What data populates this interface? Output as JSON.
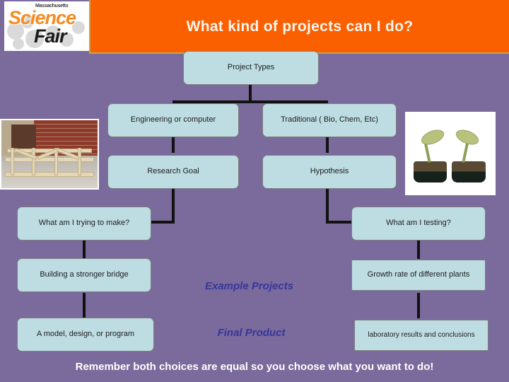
{
  "header": {
    "title": "What kind of projects can I do?",
    "logo": {
      "line_top": "Massachusetts",
      "line_main": "Science",
      "line_sub": "Fair"
    },
    "bar_color": "#fa5f00"
  },
  "theme": {
    "background_color": "#7b6a9c",
    "node_fill": "#bedde3",
    "node_border": "#7e7e7e",
    "connector_color": "#121212",
    "label_color": "#36369b",
    "title_color": "#fdf6ee"
  },
  "diagram": {
    "root": {
      "label": "Project Types"
    },
    "row_types": {
      "left": "Engineering or computer",
      "right": "Traditional ( Bio, Chem, Etc)"
    },
    "row_goal": {
      "left": "Research Goal",
      "right": "Hypothesis"
    },
    "row_question": {
      "left": "What am I trying to make?",
      "right": "What am I testing?"
    },
    "row_example": {
      "left": "Building a stronger bridge",
      "center": "Example Projects",
      "right": "Growth rate of different plants"
    },
    "row_product": {
      "left": "A model, design, or program",
      "center": "Final Product",
      "right": "laboratory results and conclusions"
    }
  },
  "photos": {
    "left": {
      "caption": "wooden-truss-bridge-photo"
    },
    "right": {
      "caption": "bean-seedlings-photo"
    }
  },
  "footer": {
    "note": "Remember both choices are equal so you choose what you want to do!"
  }
}
